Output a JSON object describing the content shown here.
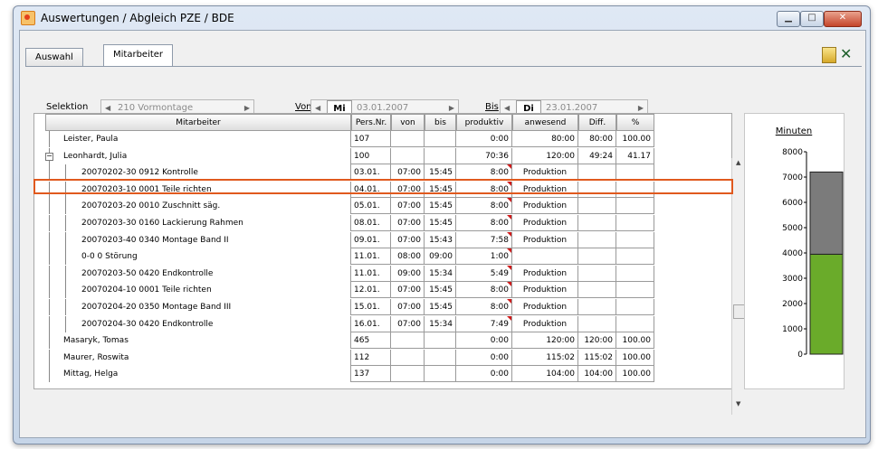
{
  "window": {
    "title": "Auswertungen / Abgleich PZE / BDE"
  },
  "tabs": [
    "Auswahl",
    "Mitarbeiter"
  ],
  "filters": {
    "selektion_label": "Selektion",
    "selektion_value": "210 Vormontage",
    "von_label": "Von",
    "von_day": "Mi",
    "von_date": "03.01.2007",
    "bis_label": "Bis",
    "bis_day": "Di",
    "bis_date": "23.01.2007"
  },
  "table": {
    "headers": [
      "Mitarbeiter",
      "Pers.Nr.",
      "von",
      "bis",
      "produktiv",
      "anwesend",
      "Diff.",
      "%"
    ],
    "rows": [
      {
        "name": "Leister, Paula",
        "persnr": "107",
        "von": "",
        "bis": "",
        "produktiv": "0:00",
        "anwesend": "80:00",
        "diff": "80:00",
        "pct": "100.00"
      },
      {
        "name": "Leonhardt, Julia",
        "persnr": "100",
        "von": "",
        "bis": "",
        "produktiv": "70:36",
        "anwesend": "120:00",
        "diff": "49:24",
        "pct": "41.17"
      },
      {
        "name": "20070202-30  0912 Kontrolle",
        "persnr": "03.01.",
        "von": "07:00",
        "bis": "15:45",
        "produktiv": "8:00",
        "anwesend": "Produktion",
        "diff": "",
        "pct": ""
      },
      {
        "name": "20070203-10  0001 Teile richten",
        "persnr": "04.01.",
        "von": "07:00",
        "bis": "15:45",
        "produktiv": "8:00",
        "anwesend": "Produktion",
        "diff": "",
        "pct": ""
      },
      {
        "name": "20070203-20  0010 Zuschnitt säg.",
        "persnr": "05.01.",
        "von": "07:00",
        "bis": "15:45",
        "produktiv": "8:00",
        "anwesend": "Produktion",
        "diff": "",
        "pct": ""
      },
      {
        "name": "20070203-30  0160 Lackierung Rahmen",
        "persnr": "08.01.",
        "von": "07:00",
        "bis": "15:45",
        "produktiv": "8:00",
        "anwesend": "Produktion",
        "diff": "",
        "pct": ""
      },
      {
        "name": "20070203-40  0340 Montage Band II",
        "persnr": "09.01.",
        "von": "07:00",
        "bis": "15:43",
        "produktiv": "7:58",
        "anwesend": "Produktion",
        "diff": "",
        "pct": ""
      },
      {
        "name": "0-0  0 Störung",
        "persnr": "11.01.",
        "von": "08:00",
        "bis": "09:00",
        "produktiv": "1:00",
        "anwesend": "",
        "diff": "",
        "pct": ""
      },
      {
        "name": "20070203-50  0420 Endkontrolle",
        "persnr": "11.01.",
        "von": "09:00",
        "bis": "15:34",
        "produktiv": "5:49",
        "anwesend": "Produktion",
        "diff": "",
        "pct": ""
      },
      {
        "name": "20070204-10  0001 Teile richten",
        "persnr": "12.01.",
        "von": "07:00",
        "bis": "15:45",
        "produktiv": "8:00",
        "anwesend": "Produktion",
        "diff": "",
        "pct": ""
      },
      {
        "name": "20070204-20  0350 Montage Band III",
        "persnr": "15.01.",
        "von": "07:00",
        "bis": "15:45",
        "produktiv": "8:00",
        "anwesend": "Produktion",
        "diff": "",
        "pct": ""
      },
      {
        "name": "20070204-30  0420 Endkontrolle",
        "persnr": "16.01.",
        "von": "07:00",
        "bis": "15:34",
        "produktiv": "7:49",
        "anwesend": "Produktion",
        "diff": "",
        "pct": ""
      },
      {
        "name": "Masaryk, Tomas",
        "persnr": "465",
        "von": "",
        "bis": "",
        "produktiv": "0:00",
        "anwesend": "120:00",
        "diff": "120:00",
        "pct": "100.00"
      },
      {
        "name": "Maurer, Roswita",
        "persnr": "112",
        "von": "",
        "bis": "",
        "produktiv": "0:00",
        "anwesend": "115:02",
        "diff": "115:02",
        "pct": "100.00"
      },
      {
        "name": "Mittag, Helga",
        "persnr": "137",
        "von": "",
        "bis": "",
        "produktiv": "0:00",
        "anwesend": "104:00",
        "diff": "104:00",
        "pct": "100.00"
      }
    ]
  },
  "chart_data": {
    "type": "bar",
    "title": "Minuten",
    "yticks": [
      "0",
      "1000",
      "2000",
      "3000",
      "4000",
      "5000",
      "6000",
      "7000",
      "8000"
    ],
    "ylim": [
      0,
      8000
    ],
    "series": [
      {
        "values": [
          3950
        ],
        "color": "#6aab2a"
      },
      {
        "values": [
          3250
        ],
        "color": "#7b7b7b"
      }
    ]
  }
}
